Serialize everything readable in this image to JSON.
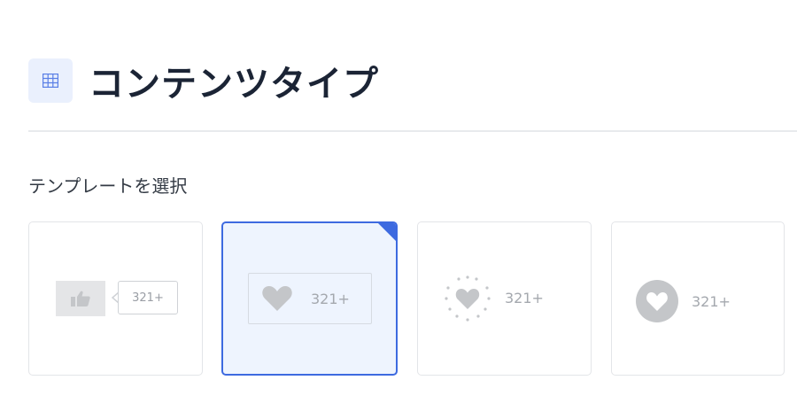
{
  "header": {
    "title": "コンテンツタイプ",
    "icon": "grid-icon"
  },
  "section": {
    "label": "テンプレートを選択"
  },
  "templates": [
    {
      "icon": "thumbs-up-icon",
      "count": "321+",
      "selected": false
    },
    {
      "icon": "heart-icon",
      "count": "321+",
      "selected": true
    },
    {
      "icon": "sparkle-heart-icon",
      "count": "321+",
      "selected": false
    },
    {
      "icon": "circle-heart-icon",
      "count": "321+",
      "selected": false
    }
  ],
  "colors": {
    "accent": "#3d6ae0",
    "selected_bg": "#eef4fe",
    "icon_grey": "#c4c6c9",
    "title": "#1b2435"
  }
}
